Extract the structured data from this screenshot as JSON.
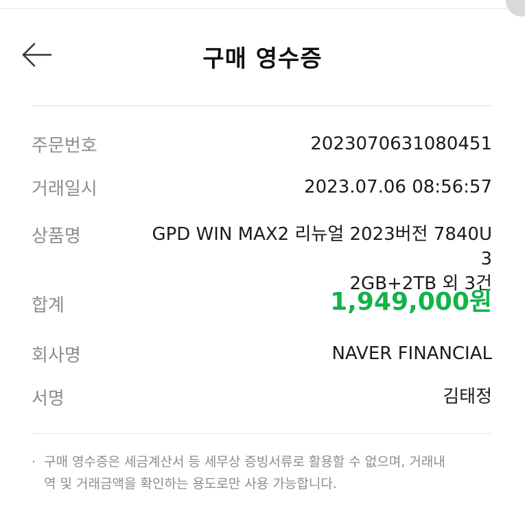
{
  "header": {
    "title": "구매 영수증"
  },
  "receipt": {
    "order_number": {
      "label": "주문번호",
      "value": "2023070631080451"
    },
    "transaction_date": {
      "label": "거래일시",
      "value": "2023.07.06 08:56:57"
    },
    "product_name": {
      "label": "상품명",
      "value_line1": "GPD WIN MAX2 리뉴얼 2023버전 7840U 3",
      "value_line2": "2GB+2TB 외 3건"
    },
    "total": {
      "label": "합계",
      "value": "1,949,000원"
    },
    "company": {
      "label": "회사명",
      "value": "NAVER FINANCIAL"
    },
    "signature": {
      "label": "서명",
      "value": "김태정"
    }
  },
  "notice": {
    "bullet": "·",
    "line1": "구매 영수증은 세금계산서 등 세무상 증빙서류로 활용할 수 없으며, 거래내",
    "line2": "역 및 거래금액을 확인하는 용도로만 사용 가능합니다."
  },
  "colors": {
    "accent_total": "#12b34a",
    "label_gray": "#8c8c8c",
    "divider": "#e3e3e3"
  },
  "icons": {
    "back": "arrow-left-icon"
  }
}
